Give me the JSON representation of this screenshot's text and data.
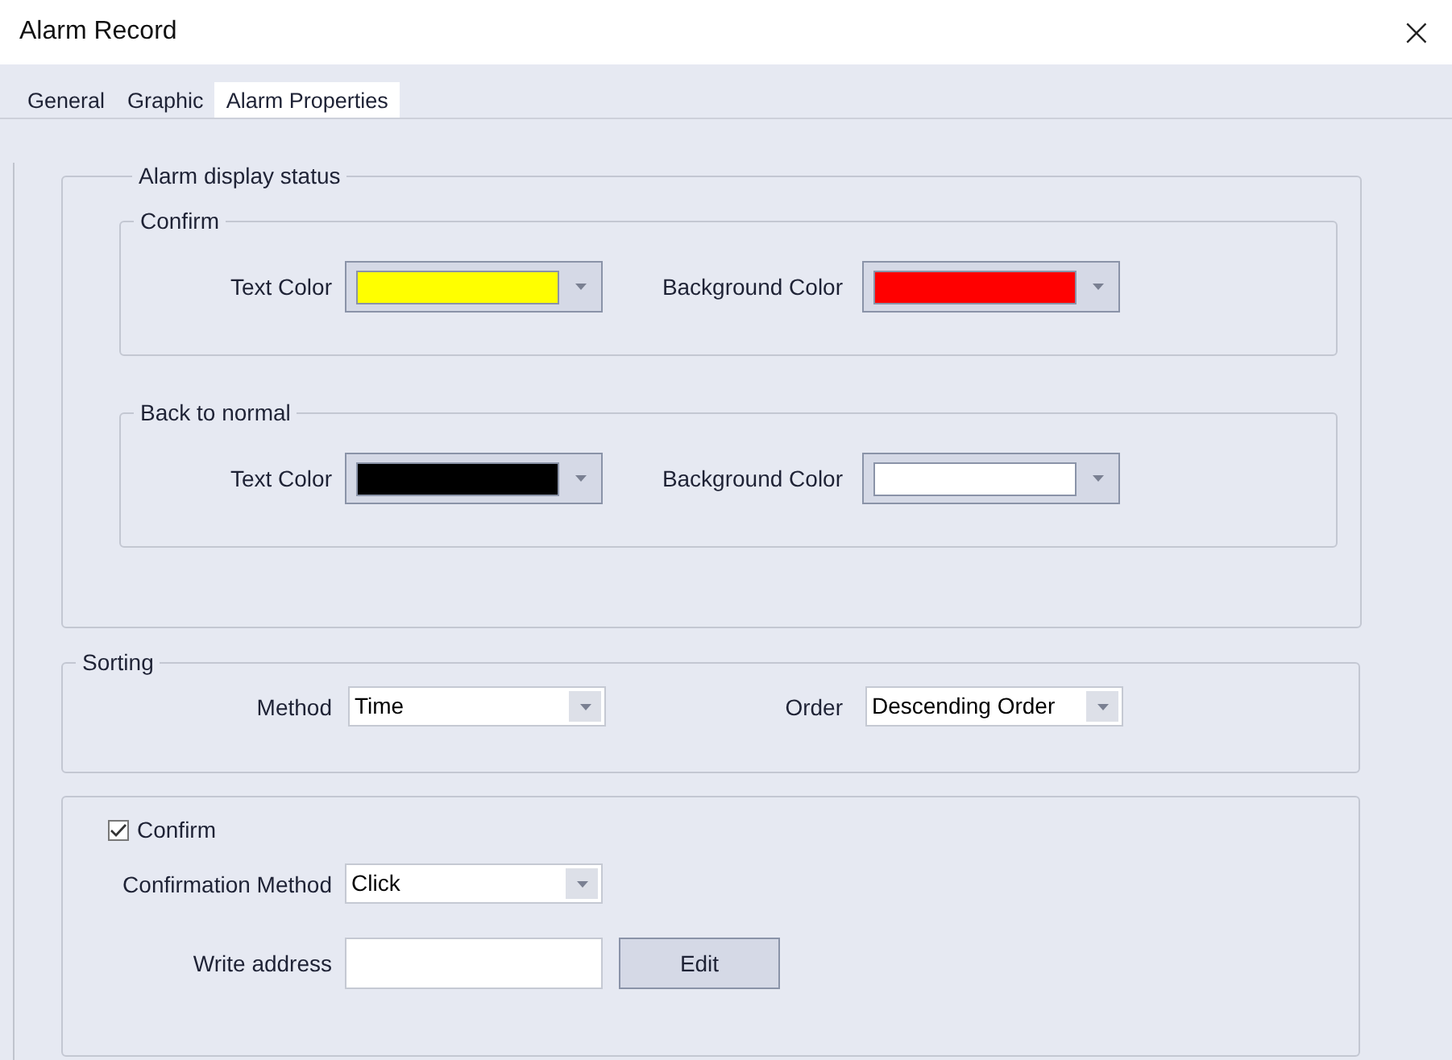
{
  "window": {
    "title": "Alarm Record",
    "close": "×"
  },
  "tabs": [
    {
      "label": "General",
      "selected": false
    },
    {
      "label": "Graphic",
      "selected": false
    },
    {
      "label": "Alarm Properties",
      "selected": true
    }
  ],
  "alarm_display_status": {
    "title": "Alarm display status",
    "groups": [
      {
        "title": "Confirm",
        "fields": [
          {
            "label": "Text Color",
            "color": "#ffff00"
          },
          {
            "label": "Background Color",
            "color": "#ff0000"
          }
        ]
      },
      {
        "title": "Back to normal",
        "fields": [
          {
            "label": "Text Color",
            "color": "#000000"
          },
          {
            "label": "Background Color",
            "color": "#ffffff"
          }
        ]
      }
    ]
  },
  "sorting": {
    "title": "Sorting",
    "method": {
      "label": "Method",
      "value": "Time"
    },
    "order": {
      "label": "Order",
      "value": "Descending Order"
    }
  },
  "confirm": {
    "label": "Confirm",
    "checked": true,
    "confirmation_method": {
      "label": "Confirmation Method",
      "value": "Click"
    },
    "write_address": {
      "label": "Write address"
    },
    "edit_button": "Edit"
  }
}
